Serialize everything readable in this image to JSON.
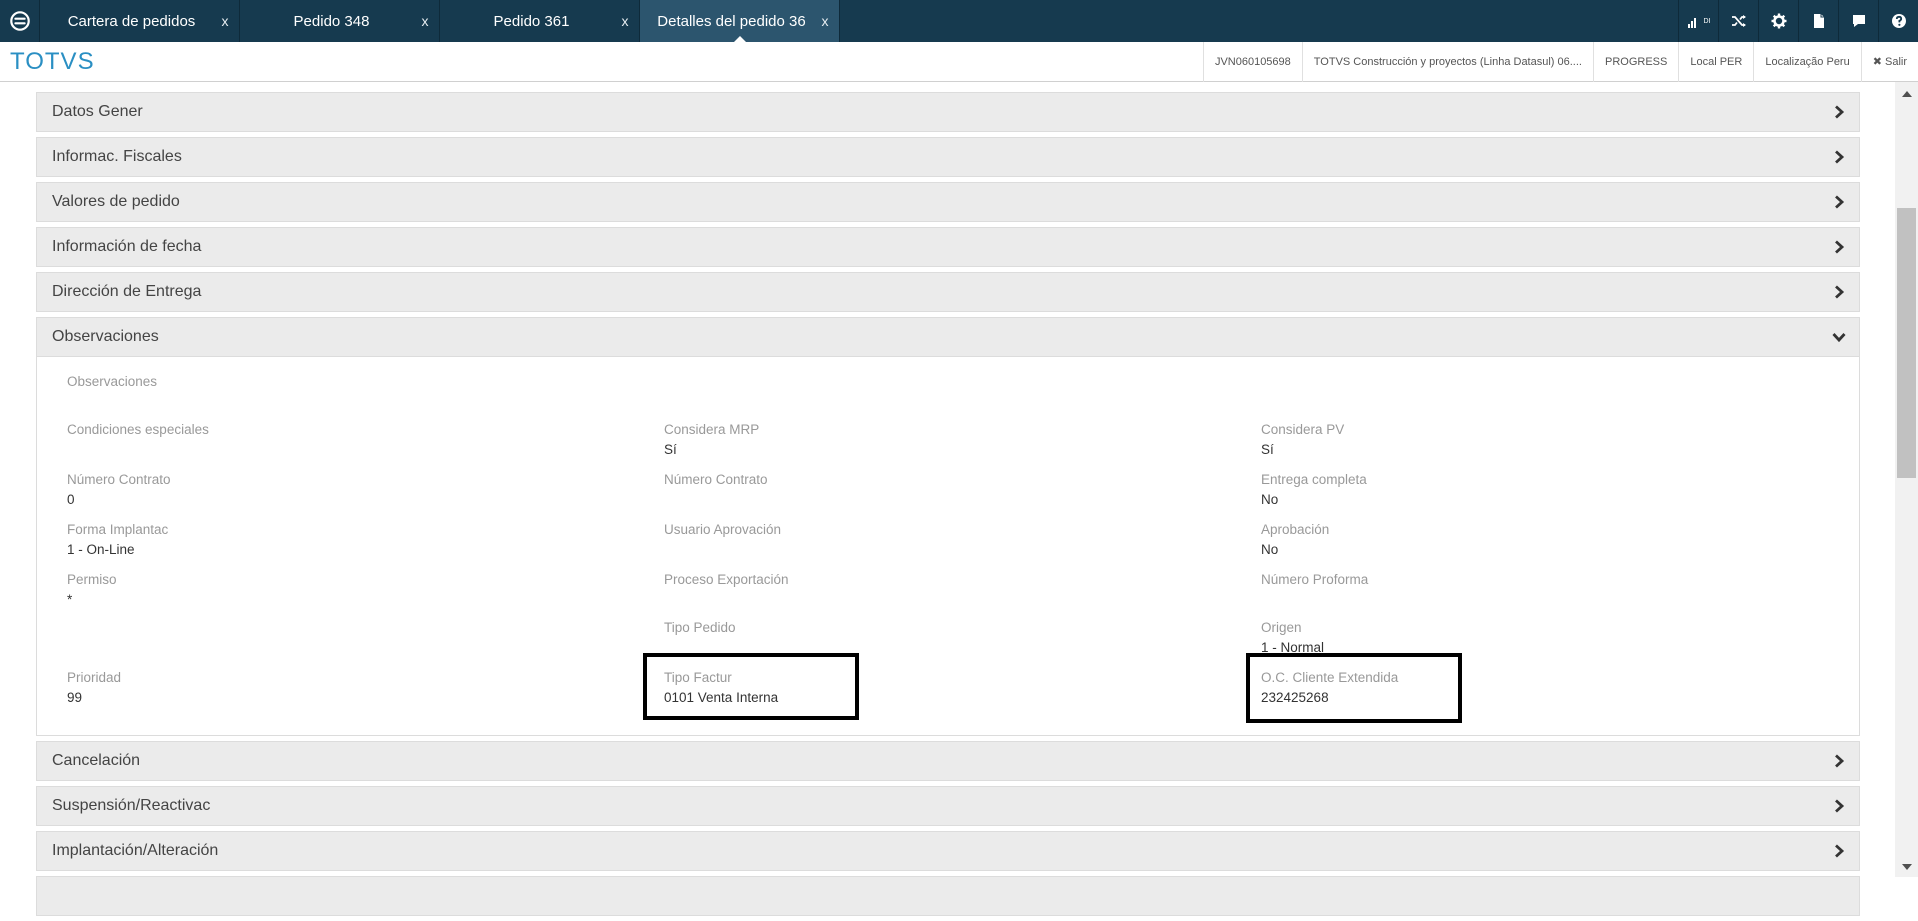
{
  "tabs": [
    {
      "label": "Cartera de pedidos",
      "close": "x"
    },
    {
      "label": "Pedido 348",
      "close": "x"
    },
    {
      "label": "Pedido 361",
      "close": "x"
    },
    {
      "label": "Detalles del pedido 36",
      "close": "x",
      "active": true
    }
  ],
  "top_icons": [
    "signal-icon",
    "shuffle-icon",
    "gear-icon",
    "document-icon",
    "chat-icon",
    "help-icon"
  ],
  "signal_badge": "DI",
  "brand": "TOTVS",
  "header_info": {
    "user": "JVN060105698",
    "company": "TOTVS Construcción y proyectos (Linha Datasul) 06....",
    "db": "PROGRESS",
    "local": "Local PER",
    "localization": "Localização Peru",
    "logout": "✖ Salir"
  },
  "sections_top": [
    {
      "title": "Datos Gener"
    },
    {
      "title": "Informac. Fiscales"
    },
    {
      "title": "Valores de pedido"
    },
    {
      "title": "Información de fecha"
    },
    {
      "title": "Dirección de Entrega"
    }
  ],
  "observations": {
    "title": "Observaciones",
    "obs_label": "Observaciones",
    "fields": {
      "condiciones": {
        "label": "Condiciones especiales",
        "value": ""
      },
      "considera_mrp": {
        "label": "Considera MRP",
        "value": "Sí"
      },
      "considera_pv": {
        "label": "Considera PV",
        "value": "Sí"
      },
      "numero_contrato_1": {
        "label": "Número Contrato",
        "value": "0"
      },
      "numero_contrato_2": {
        "label": "Número Contrato",
        "value": ""
      },
      "entrega_completa": {
        "label": "Entrega completa",
        "value": "No"
      },
      "forma_implantac": {
        "label": "Forma Implantac",
        "value": "1 - On-Line"
      },
      "usuario_aprovacion": {
        "label": "Usuario Aprovación",
        "value": ""
      },
      "aprobacion": {
        "label": "Aprobación",
        "value": "No"
      },
      "permiso": {
        "label": "Permiso",
        "value": "*"
      },
      "proceso_exportacion": {
        "label": "Proceso Exportación",
        "value": ""
      },
      "numero_proforma": {
        "label": "Número Proforma",
        "value": ""
      },
      "tipo_pedido": {
        "label": "Tipo Pedido",
        "value": ""
      },
      "origen": {
        "label": "Origen",
        "value": "1 - Normal"
      },
      "prioridad": {
        "label": "Prioridad",
        "value": "99"
      },
      "tipo_factur": {
        "label": "Tipo Factur",
        "value": "0101 Venta Interna"
      },
      "oc_cliente": {
        "label": "O.C. Cliente Extendida",
        "value": "232425268"
      }
    }
  },
  "sections_bottom": [
    {
      "title": "Cancelación"
    },
    {
      "title": "Suspensión/Reactivac"
    },
    {
      "title": "Implantación/Alteración"
    }
  ]
}
